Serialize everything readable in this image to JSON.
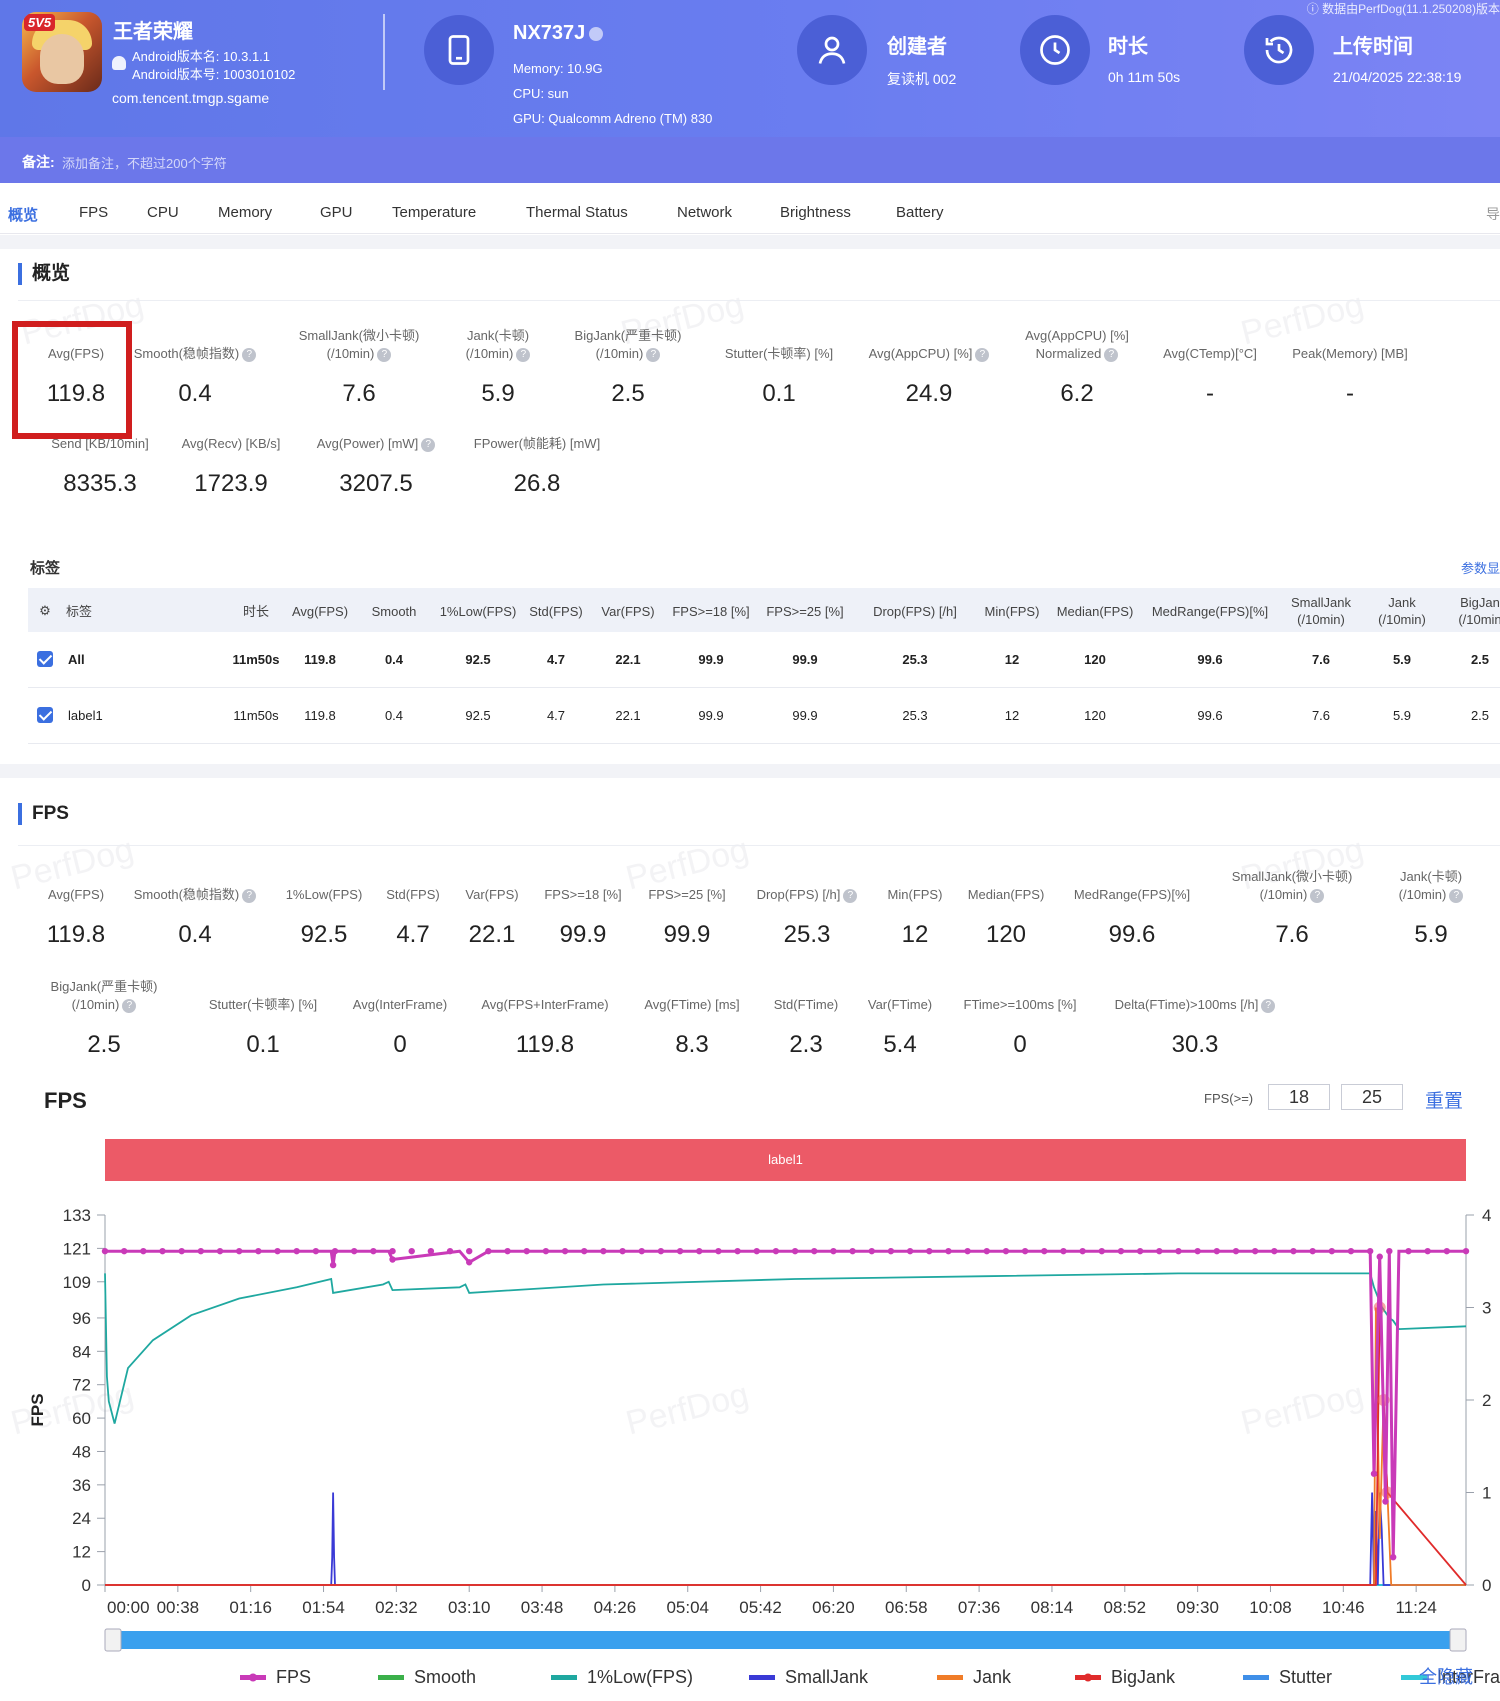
{
  "header": {
    "app_name": "王者荣耀",
    "app_badge": "5V5",
    "android_version": "Android版本名: 10.3.1.1",
    "android_code": "Android版本号: 1003010102",
    "package": "com.tencent.tmgp.sgame",
    "device_name": "NX737J",
    "memory": "Memory: 10.9G",
    "cpu": "CPU: sun",
    "gpu": "GPU: Qualcomm Adreno (TM) 830",
    "creator_label": "创建者",
    "creator_value": "复读机 002",
    "duration_label": "时长",
    "duration_value": "0h 11m 50s",
    "upload_label": "上传时间",
    "upload_value": "21/04/2025 22:38:19",
    "data_source": "ⓘ 数据由PerfDog(11.1.250208)版本",
    "note_label": "备注:",
    "note_placeholder": "添加备注，不超过200个字符",
    "icons": [
      "tablet-icon",
      "user-icon",
      "clock-icon",
      "history-icon"
    ]
  },
  "tabs": [
    "概览",
    "FPS",
    "CPU",
    "Memory",
    "GPU",
    "Temperature",
    "Thermal Status",
    "Network",
    "Brightness",
    "Battery"
  ],
  "tabs_right": "导",
  "overview": {
    "title": "概览",
    "row1": [
      {
        "label": "Avg(FPS)",
        "value": "119.8"
      },
      {
        "label": "Smooth(稳帧指数)",
        "value": "0.4"
      },
      {
        "label": "SmallJank(微小卡顿)\n(/10min)",
        "value": "7.6"
      },
      {
        "label": "Jank(卡顿)\n(/10min)",
        "value": "5.9"
      },
      {
        "label": "BigJank(严重卡顿)\n(/10min)",
        "value": "2.5"
      },
      {
        "label": "Stutter(卡顿率) [%]",
        "value": "0.1"
      },
      {
        "label": "Avg(AppCPU) [%]",
        "value": "24.9"
      },
      {
        "label": "Avg(AppCPU) [%]\nNormalized",
        "value": "6.2"
      },
      {
        "label": "Avg(CTemp)[°C]",
        "value": "-"
      },
      {
        "label": "Peak(Memory) [MB]",
        "value": "-"
      }
    ],
    "row2": [
      {
        "label": "Send [KB/10min]",
        "value": "8335.3"
      },
      {
        "label": "Avg(Recv) [KB/s]",
        "value": "1723.9"
      },
      {
        "label": "Avg(Power) [mW]",
        "value": "3207.5"
      },
      {
        "label": "FPower(帧能耗) [mW]",
        "value": "26.8"
      }
    ]
  },
  "tags": {
    "title": "标签",
    "link": "参数显",
    "headers": [
      "标签",
      "时长",
      "Avg(FPS)",
      "Smooth",
      "1%Low(FPS)",
      "Std(FPS)",
      "Var(FPS)",
      "FPS>=18 [%]",
      "FPS>=25 [%]",
      "Drop(FPS) [/h]",
      "Min(FPS)",
      "Median(FPS)",
      "MedRange(FPS)[%]",
      "SmallJank\n(/10min)",
      "Jank\n(/10min)",
      "BigJan\n(/10min"
    ],
    "rows": [
      [
        "All",
        "11m50s",
        "119.8",
        "0.4",
        "92.5",
        "4.7",
        "22.1",
        "99.9",
        "99.9",
        "25.3",
        "12",
        "120",
        "99.6",
        "7.6",
        "5.9",
        "2.5"
      ],
      [
        "label1",
        "11m50s",
        "119.8",
        "0.4",
        "92.5",
        "4.7",
        "22.1",
        "99.9",
        "99.9",
        "25.3",
        "12",
        "120",
        "99.6",
        "7.6",
        "5.9",
        "2.5"
      ]
    ]
  },
  "fps_section": {
    "title": "FPS",
    "row1": [
      {
        "label": "Avg(FPS)",
        "value": "119.8"
      },
      {
        "label": "Smooth(稳帧指数)",
        "value": "0.4"
      },
      {
        "label": "1%Low(FPS)",
        "value": "92.5"
      },
      {
        "label": "Std(FPS)",
        "value": "4.7"
      },
      {
        "label": "Var(FPS)",
        "value": "22.1"
      },
      {
        "label": "FPS>=18 [%]",
        "value": "99.9"
      },
      {
        "label": "FPS>=25 [%]",
        "value": "99.9"
      },
      {
        "label": "Drop(FPS) [/h]",
        "value": "25.3"
      },
      {
        "label": "Min(FPS)",
        "value": "12"
      },
      {
        "label": "Median(FPS)",
        "value": "120"
      },
      {
        "label": "MedRange(FPS)[%]",
        "value": "99.6"
      },
      {
        "label": "SmallJank(微小卡顿)\n(/10min)",
        "value": "7.6"
      },
      {
        "label": "Jank(卡顿)\n(/10min)",
        "value": "5.9"
      }
    ],
    "row2": [
      {
        "label": "BigJank(严重卡顿)\n(/10min)",
        "value": "2.5"
      },
      {
        "label": "Stutter(卡顿率) [%]",
        "value": "0.1"
      },
      {
        "label": "Avg(InterFrame)",
        "value": "0"
      },
      {
        "label": "Avg(FPS+InterFrame)",
        "value": "119.8"
      },
      {
        "label": "Avg(FTime) [ms]",
        "value": "8.3"
      },
      {
        "label": "Std(FTime)",
        "value": "2.3"
      },
      {
        "label": "Var(FTime)",
        "value": "5.4"
      },
      {
        "label": "FTime>=100ms [%]",
        "value": "0"
      },
      {
        "label": "Delta(FTime)>100ms [/h]",
        "value": "30.3"
      }
    ]
  },
  "chart_controls": {
    "heading": "FPS",
    "threshold_label": "FPS(>=)",
    "threshold_1": "18",
    "threshold_2": "25",
    "reset": "重置",
    "label_band": "label1",
    "hide_all": "全隐藏"
  },
  "watermark": "PerfDog",
  "colors": {
    "accent": "#3b6fe0",
    "fps": "#c93ab8",
    "smooth": "#3bb04a",
    "low1": "#1fa8a0",
    "smalljank": "#3a3ad6",
    "jank": "#f07c28",
    "bigjank": "#e02b2b",
    "stutter": "#3f8fe8",
    "interframe": "#32c9d8"
  },
  "chart_data": {
    "type": "line",
    "ylabel": "FPS",
    "y_ticks": [
      0,
      12,
      24,
      36,
      48,
      60,
      72,
      84,
      96,
      109,
      121,
      133
    ],
    "y_range": [
      0,
      133
    ],
    "y2_ticks": [
      0,
      1,
      2,
      3,
      4
    ],
    "y2_range": [
      0,
      4
    ],
    "x_range": [
      0,
      710
    ],
    "x_tick_labels": [
      "00:00",
      "00:38",
      "01:16",
      "01:54",
      "02:32",
      "03:10",
      "03:48",
      "04:26",
      "05:04",
      "05:42",
      "06:20",
      "06:58",
      "07:36",
      "08:14",
      "08:52",
      "09:30",
      "10:08",
      "10:46",
      "11:24"
    ],
    "x_tick_seconds": [
      0,
      38,
      76,
      114,
      152,
      190,
      228,
      266,
      304,
      342,
      380,
      418,
      456,
      494,
      532,
      570,
      608,
      646,
      684
    ],
    "legend": [
      "FPS",
      "Smooth",
      "1%Low(FPS)",
      "SmallJank",
      "Jank",
      "BigJank",
      "Stutter",
      "InterFrame"
    ],
    "series": [
      {
        "name": "FPS",
        "axis": "left",
        "x": [
          0,
          100,
          118,
          119,
          120,
          148,
          150,
          185,
          190,
          200,
          400,
          660,
          662,
          665,
          668,
          670,
          672,
          675,
          680,
          710
        ],
        "y": [
          120,
          120,
          120,
          115,
          120,
          120,
          117,
          120,
          116,
          120,
          120,
          120,
          40,
          118,
          30,
          120,
          10,
          120,
          120,
          120
        ]
      },
      {
        "name": "1%Low(FPS)",
        "axis": "left",
        "x": [
          0,
          1,
          2,
          5,
          12,
          25,
          45,
          70,
          100,
          118,
          119,
          145,
          148,
          150,
          185,
          188,
          190,
          260,
          360,
          460,
          560,
          660,
          662,
          666,
          668,
          670,
          672,
          675,
          710
        ],
        "y": [
          112,
          75,
          66,
          58,
          78,
          88,
          97,
          103,
          107,
          110,
          105,
          108,
          109,
          106,
          107,
          108,
          105,
          108,
          110,
          111,
          112,
          112,
          107,
          100,
          98,
          96,
          95,
          92,
          93
        ]
      },
      {
        "name": "SmallJank",
        "axis": "right",
        "x": [
          0,
          118,
          118.5,
          119,
          119.5,
          120,
          660,
          661,
          662,
          663,
          664,
          665,
          666,
          667,
          710
        ],
        "y": [
          0,
          0,
          0.3,
          1.0,
          0.3,
          0,
          0,
          1.0,
          0,
          0.8,
          0,
          1.0,
          0.6,
          0,
          0
        ]
      },
      {
        "name": "Jank",
        "axis": "right",
        "x": [
          0,
          662,
          663,
          665,
          667,
          669,
          671,
          710
        ],
        "y": [
          0,
          0,
          3.0,
          0.5,
          2.0,
          1.0,
          0,
          0
        ]
      },
      {
        "name": "BigJank",
        "axis": "right",
        "x": [
          0,
          663,
          665,
          667,
          669,
          710
        ],
        "y": [
          0,
          0,
          3.0,
          2.0,
          1.0,
          0
        ]
      },
      {
        "name": "Smooth",
        "axis": "right",
        "x": [
          0,
          710
        ],
        "y": [
          0,
          0
        ]
      },
      {
        "name": "Stutter",
        "axis": "right",
        "x": [
          0,
          710
        ],
        "y": [
          0,
          0
        ]
      },
      {
        "name": "InterFrame",
        "axis": "right",
        "x": [
          0,
          710
        ],
        "y": [
          0,
          0
        ]
      }
    ]
  }
}
